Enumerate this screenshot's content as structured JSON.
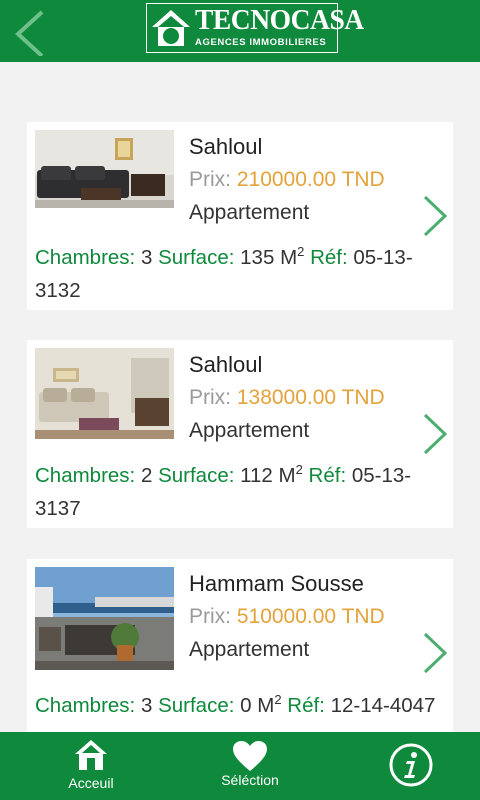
{
  "header": {
    "logo_name": "TECNOCASA",
    "logo_subtitle": "AGENCES IMMOBILIERES",
    "back_icon": "back-chevron-icon",
    "accent_color": "#0f8a3c"
  },
  "labels": {
    "price": "Prix:",
    "rooms": "Chambres:",
    "surface": "Surface:",
    "surface_unit": "M",
    "surface_exp": "2",
    "ref": "Réf:"
  },
  "listings": [
    {
      "city": "Sahloul",
      "price": "210000.00 TND",
      "type": "Appartement",
      "rooms": "3",
      "surface": "135",
      "ref": "05-13-3132"
    },
    {
      "city": "Sahloul",
      "price": "138000.00 TND",
      "type": "Appartement",
      "rooms": "2",
      "surface": "112",
      "ref": "05-13-3137"
    },
    {
      "city": "Hammam Sousse",
      "price": "510000.00 TND",
      "type": "Appartement",
      "rooms": "3",
      "surface": "0",
      "ref": "12-14-4047"
    }
  ],
  "bottom_nav": {
    "home_label": "Acceuil",
    "selection_label": "Séléction",
    "home_icon": "home-icon",
    "selection_icon": "heart-icon",
    "info_icon": "info-icon"
  },
  "price_color": "#e4a33a"
}
